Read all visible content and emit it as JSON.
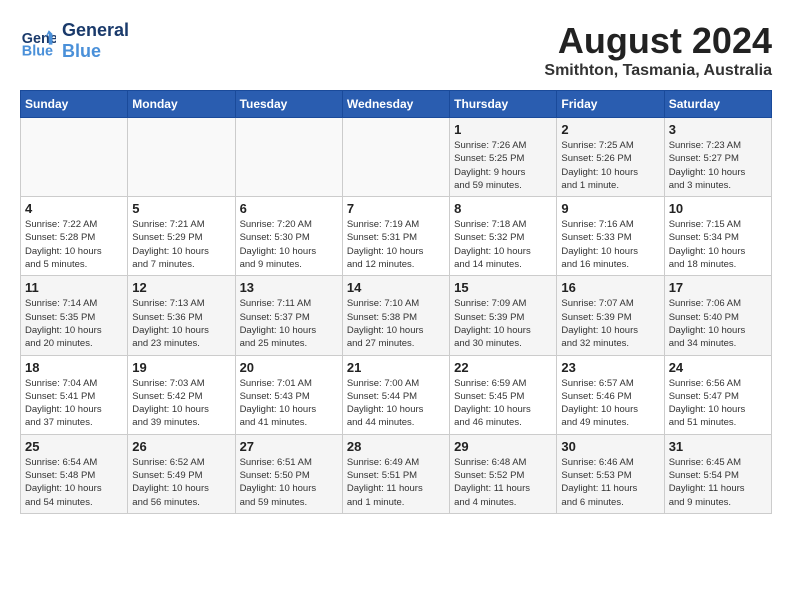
{
  "logo": {
    "line1": "General",
    "line2": "Blue"
  },
  "title": "August 2024",
  "location": "Smithton, Tasmania, Australia",
  "days_of_week": [
    "Sunday",
    "Monday",
    "Tuesday",
    "Wednesday",
    "Thursday",
    "Friday",
    "Saturday"
  ],
  "weeks": [
    [
      {
        "day": "",
        "info": ""
      },
      {
        "day": "",
        "info": ""
      },
      {
        "day": "",
        "info": ""
      },
      {
        "day": "",
        "info": ""
      },
      {
        "day": "1",
        "info": "Sunrise: 7:26 AM\nSunset: 5:25 PM\nDaylight: 9 hours\nand 59 minutes."
      },
      {
        "day": "2",
        "info": "Sunrise: 7:25 AM\nSunset: 5:26 PM\nDaylight: 10 hours\nand 1 minute."
      },
      {
        "day": "3",
        "info": "Sunrise: 7:23 AM\nSunset: 5:27 PM\nDaylight: 10 hours\nand 3 minutes."
      }
    ],
    [
      {
        "day": "4",
        "info": "Sunrise: 7:22 AM\nSunset: 5:28 PM\nDaylight: 10 hours\nand 5 minutes."
      },
      {
        "day": "5",
        "info": "Sunrise: 7:21 AM\nSunset: 5:29 PM\nDaylight: 10 hours\nand 7 minutes."
      },
      {
        "day": "6",
        "info": "Sunrise: 7:20 AM\nSunset: 5:30 PM\nDaylight: 10 hours\nand 9 minutes."
      },
      {
        "day": "7",
        "info": "Sunrise: 7:19 AM\nSunset: 5:31 PM\nDaylight: 10 hours\nand 12 minutes."
      },
      {
        "day": "8",
        "info": "Sunrise: 7:18 AM\nSunset: 5:32 PM\nDaylight: 10 hours\nand 14 minutes."
      },
      {
        "day": "9",
        "info": "Sunrise: 7:16 AM\nSunset: 5:33 PM\nDaylight: 10 hours\nand 16 minutes."
      },
      {
        "day": "10",
        "info": "Sunrise: 7:15 AM\nSunset: 5:34 PM\nDaylight: 10 hours\nand 18 minutes."
      }
    ],
    [
      {
        "day": "11",
        "info": "Sunrise: 7:14 AM\nSunset: 5:35 PM\nDaylight: 10 hours\nand 20 minutes."
      },
      {
        "day": "12",
        "info": "Sunrise: 7:13 AM\nSunset: 5:36 PM\nDaylight: 10 hours\nand 23 minutes."
      },
      {
        "day": "13",
        "info": "Sunrise: 7:11 AM\nSunset: 5:37 PM\nDaylight: 10 hours\nand 25 minutes."
      },
      {
        "day": "14",
        "info": "Sunrise: 7:10 AM\nSunset: 5:38 PM\nDaylight: 10 hours\nand 27 minutes."
      },
      {
        "day": "15",
        "info": "Sunrise: 7:09 AM\nSunset: 5:39 PM\nDaylight: 10 hours\nand 30 minutes."
      },
      {
        "day": "16",
        "info": "Sunrise: 7:07 AM\nSunset: 5:39 PM\nDaylight: 10 hours\nand 32 minutes."
      },
      {
        "day": "17",
        "info": "Sunrise: 7:06 AM\nSunset: 5:40 PM\nDaylight: 10 hours\nand 34 minutes."
      }
    ],
    [
      {
        "day": "18",
        "info": "Sunrise: 7:04 AM\nSunset: 5:41 PM\nDaylight: 10 hours\nand 37 minutes."
      },
      {
        "day": "19",
        "info": "Sunrise: 7:03 AM\nSunset: 5:42 PM\nDaylight: 10 hours\nand 39 minutes."
      },
      {
        "day": "20",
        "info": "Sunrise: 7:01 AM\nSunset: 5:43 PM\nDaylight: 10 hours\nand 41 minutes."
      },
      {
        "day": "21",
        "info": "Sunrise: 7:00 AM\nSunset: 5:44 PM\nDaylight: 10 hours\nand 44 minutes."
      },
      {
        "day": "22",
        "info": "Sunrise: 6:59 AM\nSunset: 5:45 PM\nDaylight: 10 hours\nand 46 minutes."
      },
      {
        "day": "23",
        "info": "Sunrise: 6:57 AM\nSunset: 5:46 PM\nDaylight: 10 hours\nand 49 minutes."
      },
      {
        "day": "24",
        "info": "Sunrise: 6:56 AM\nSunset: 5:47 PM\nDaylight: 10 hours\nand 51 minutes."
      }
    ],
    [
      {
        "day": "25",
        "info": "Sunrise: 6:54 AM\nSunset: 5:48 PM\nDaylight: 10 hours\nand 54 minutes."
      },
      {
        "day": "26",
        "info": "Sunrise: 6:52 AM\nSunset: 5:49 PM\nDaylight: 10 hours\nand 56 minutes."
      },
      {
        "day": "27",
        "info": "Sunrise: 6:51 AM\nSunset: 5:50 PM\nDaylight: 10 hours\nand 59 minutes."
      },
      {
        "day": "28",
        "info": "Sunrise: 6:49 AM\nSunset: 5:51 PM\nDaylight: 11 hours\nand 1 minute."
      },
      {
        "day": "29",
        "info": "Sunrise: 6:48 AM\nSunset: 5:52 PM\nDaylight: 11 hours\nand 4 minutes."
      },
      {
        "day": "30",
        "info": "Sunrise: 6:46 AM\nSunset: 5:53 PM\nDaylight: 11 hours\nand 6 minutes."
      },
      {
        "day": "31",
        "info": "Sunrise: 6:45 AM\nSunset: 5:54 PM\nDaylight: 11 hours\nand 9 minutes."
      }
    ]
  ]
}
